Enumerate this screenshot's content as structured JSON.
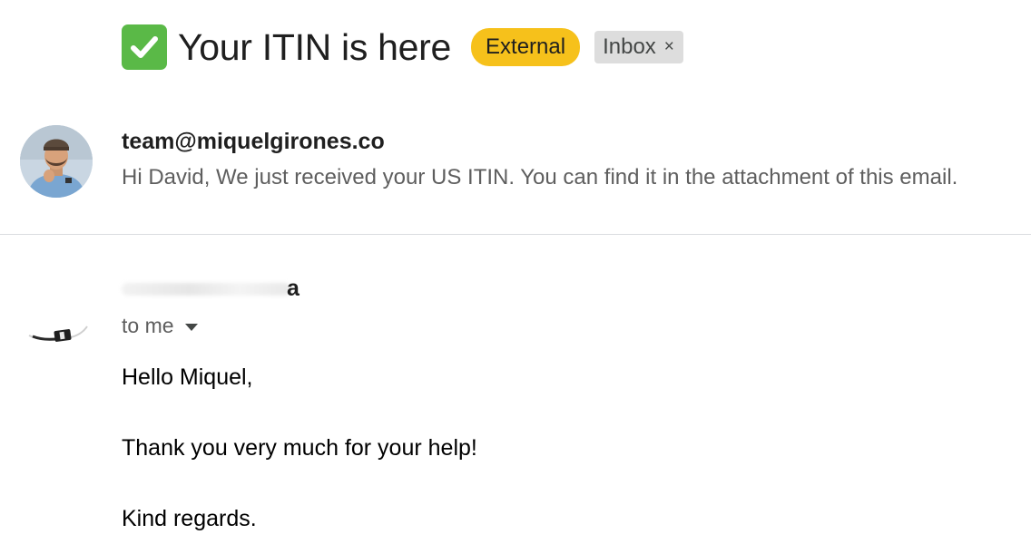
{
  "subject": {
    "emoji_icon": "white-check-mark-icon",
    "title": "Your ITIN is here",
    "labels": {
      "external": "External",
      "inbox": "Inbox",
      "remove_symbol": "×"
    }
  },
  "thread": {
    "message_1": {
      "sender": "team@miquelgirones.co",
      "snippet": "Hi David, We just received your US ITIN. You can find it in the attachment of this email."
    },
    "message_2": {
      "sender_visible_tail": "a",
      "recipient_line": "to me",
      "body": {
        "greeting": "Hello Miquel,",
        "line": "Thank you very much for your help!",
        "closing": "Kind regards."
      }
    }
  },
  "colors": {
    "external_label": "#f6c11b",
    "inbox_label": "#dddddd",
    "check_emoji": "#5ab947",
    "divider": "#dadce0"
  }
}
